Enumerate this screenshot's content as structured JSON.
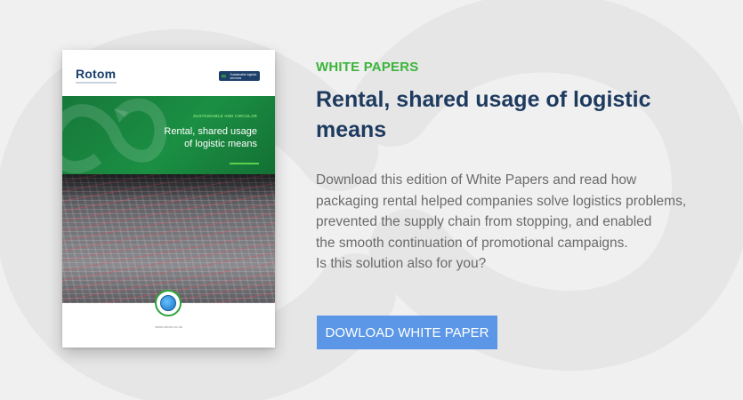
{
  "brochure": {
    "logo": "Rotom",
    "badge_text": "Sustainable logistic services",
    "eyebrow": "SUSTAINABLE AND CIRCULAR",
    "title_line1": "Rental, shared usage",
    "title_line2": "of logistic means",
    "url": "www.rotom.co.uk"
  },
  "content": {
    "eyebrow": "WHITE PAPERS",
    "headline": "Rental, shared usage of logistic means",
    "body_lines": [
      "Download this edition of White Papers and read how",
      "packaging rental helped companies solve logistics problems,",
      "prevented the supply chain from stopping, and enabled",
      "the smooth continuation of promotional campaigns.",
      "Is this solution also for you?"
    ],
    "cta_label": "DOWLOAD WHITE PAPER"
  },
  "colors": {
    "background": "#f0f0f0",
    "accent_green": "#3cb43c",
    "headline_navy": "#1d3a5f",
    "body_gray": "#6b6b6b",
    "button_blue": "#5b97e6",
    "brochure_green": "#1b8f43"
  },
  "icons": {
    "background_mark": "infinity-arrow-icon",
    "brochure_mark": "infinity-arrow-icon",
    "badge_icon": "globe-icon"
  }
}
